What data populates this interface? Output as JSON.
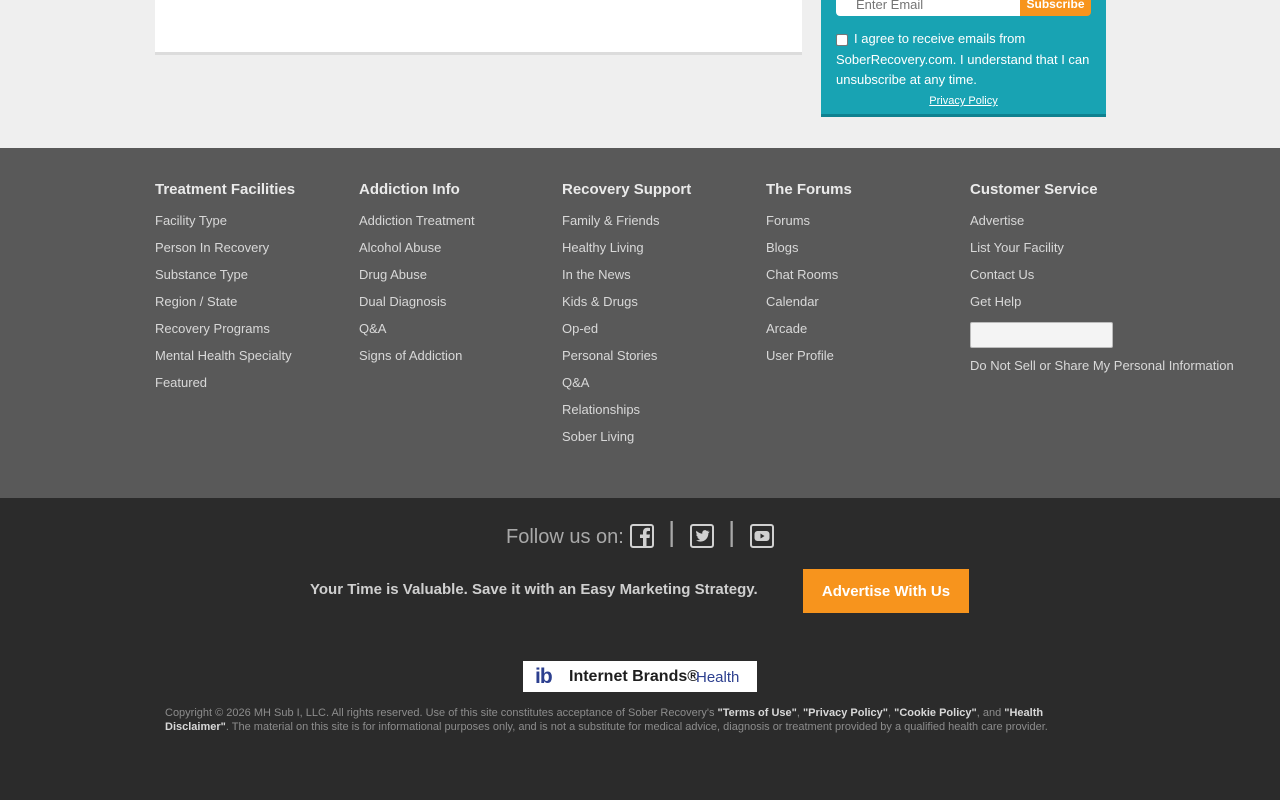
{
  "newsletter": {
    "email_placeholder": "Enter Email",
    "subscribe_label": "Subscribe",
    "consent_text": "I agree to receive emails from SoberRecovery.com. I understand that I can unsubscribe at any time.",
    "privacy_label": "Privacy Policy"
  },
  "columns": [
    {
      "title": "Treatment Facilities",
      "links": [
        "Facility Type",
        "Person In Recovery",
        "Substance Type",
        "Region / State",
        "Recovery Programs",
        "Mental Health Specialty",
        "Featured"
      ]
    },
    {
      "title": "Addiction Info",
      "links": [
        "Addiction Treatment",
        "Alcohol Abuse",
        "Drug Abuse",
        "Dual Diagnosis",
        "Q&A",
        "Signs of Addiction"
      ]
    },
    {
      "title": "Recovery Support",
      "links": [
        "Family & Friends",
        "Healthy Living",
        "In the News",
        "Kids & Drugs",
        "Op-ed",
        "Personal Stories",
        "Q&A",
        "Relationships",
        "Sober Living"
      ]
    },
    {
      "title": "The Forums",
      "links": [
        "Forums",
        "Blogs",
        "Chat Rooms",
        "Calendar",
        "Arcade",
        "User Profile"
      ]
    },
    {
      "title": "Customer Service",
      "links": [
        "Advertise",
        "List Your Facility",
        "Contact Us",
        "Get Help"
      ],
      "extra": "Do Not Sell or Share My Personal Information"
    }
  ],
  "follow": {
    "label": "Follow us on:",
    "separator": "|",
    "icons": [
      "facebook-icon",
      "twitter-icon",
      "youtube-icon"
    ]
  },
  "promo": {
    "tagline": "Your Time is Valuable. Save it with an Easy Marketing Strategy.",
    "button": "Advertise With Us"
  },
  "logo": {
    "mark": "ib",
    "name": "Internet Brands®",
    "health": "Health"
  },
  "copyright": {
    "prefix": "Copyright © 2026 MH Sub I, LLC. All rights reserved. Use of this site constitutes acceptance of Sober Recovery's ",
    "terms": "\"Terms of Use\"",
    "comma1": ", ",
    "privacy": "\"Privacy Policy\"",
    "comma2": ", ",
    "cookie": "\"Cookie Policy\"",
    "and": ", and ",
    "disclaimer": "\"Health Disclaimer\"",
    "suffix": ". The material on this site is for informational purposes only, and is not a substitute for medical advice, diagnosis or treatment provided by a qualified health care provider."
  },
  "colors": {
    "teal": "#18a3b3",
    "orange": "#f7941d",
    "footer_gray": "#595959",
    "footer_dark": "#2b2b2b"
  }
}
